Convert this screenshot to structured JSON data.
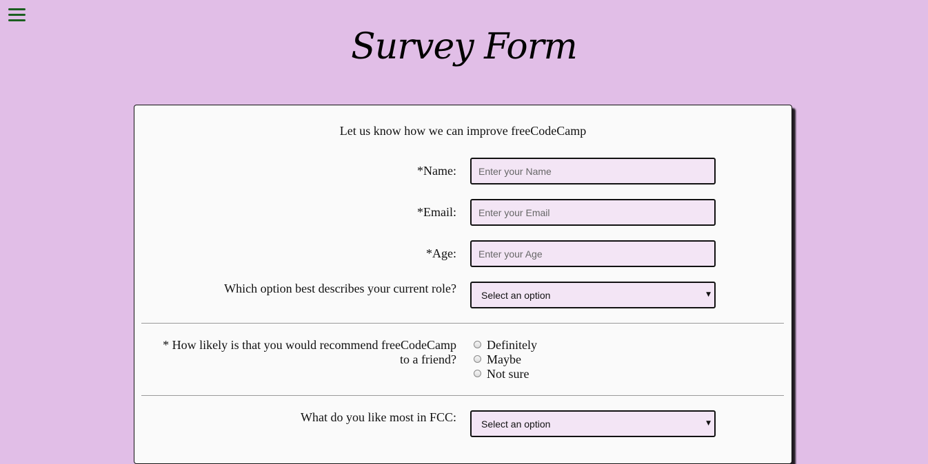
{
  "page": {
    "title": "Survey Form",
    "background_color": "#e1bee7",
    "accent_color": "#1b5e20",
    "field_bg_color": "#f3e5f5"
  },
  "menu": {
    "icon": "hamburger-menu-icon"
  },
  "form": {
    "description": "Let us know how we can improve freeCodeCamp",
    "name": {
      "label": "*Name:",
      "placeholder": "Enter your Name",
      "value": ""
    },
    "email": {
      "label": "*Email:",
      "placeholder": "Enter your Email",
      "value": ""
    },
    "age": {
      "label": "*Age:",
      "placeholder": "Enter your Age",
      "value": ""
    },
    "role": {
      "label": "Which option best describes your current role?",
      "selected": "Select an option"
    },
    "recommend": {
      "label": "* How likely is that you would recommend freeCodeCamp to a friend?",
      "options": [
        "Definitely",
        "Maybe",
        "Not sure"
      ]
    },
    "like_most": {
      "label": "What do you like most in FCC:",
      "selected": "Select an option"
    }
  }
}
